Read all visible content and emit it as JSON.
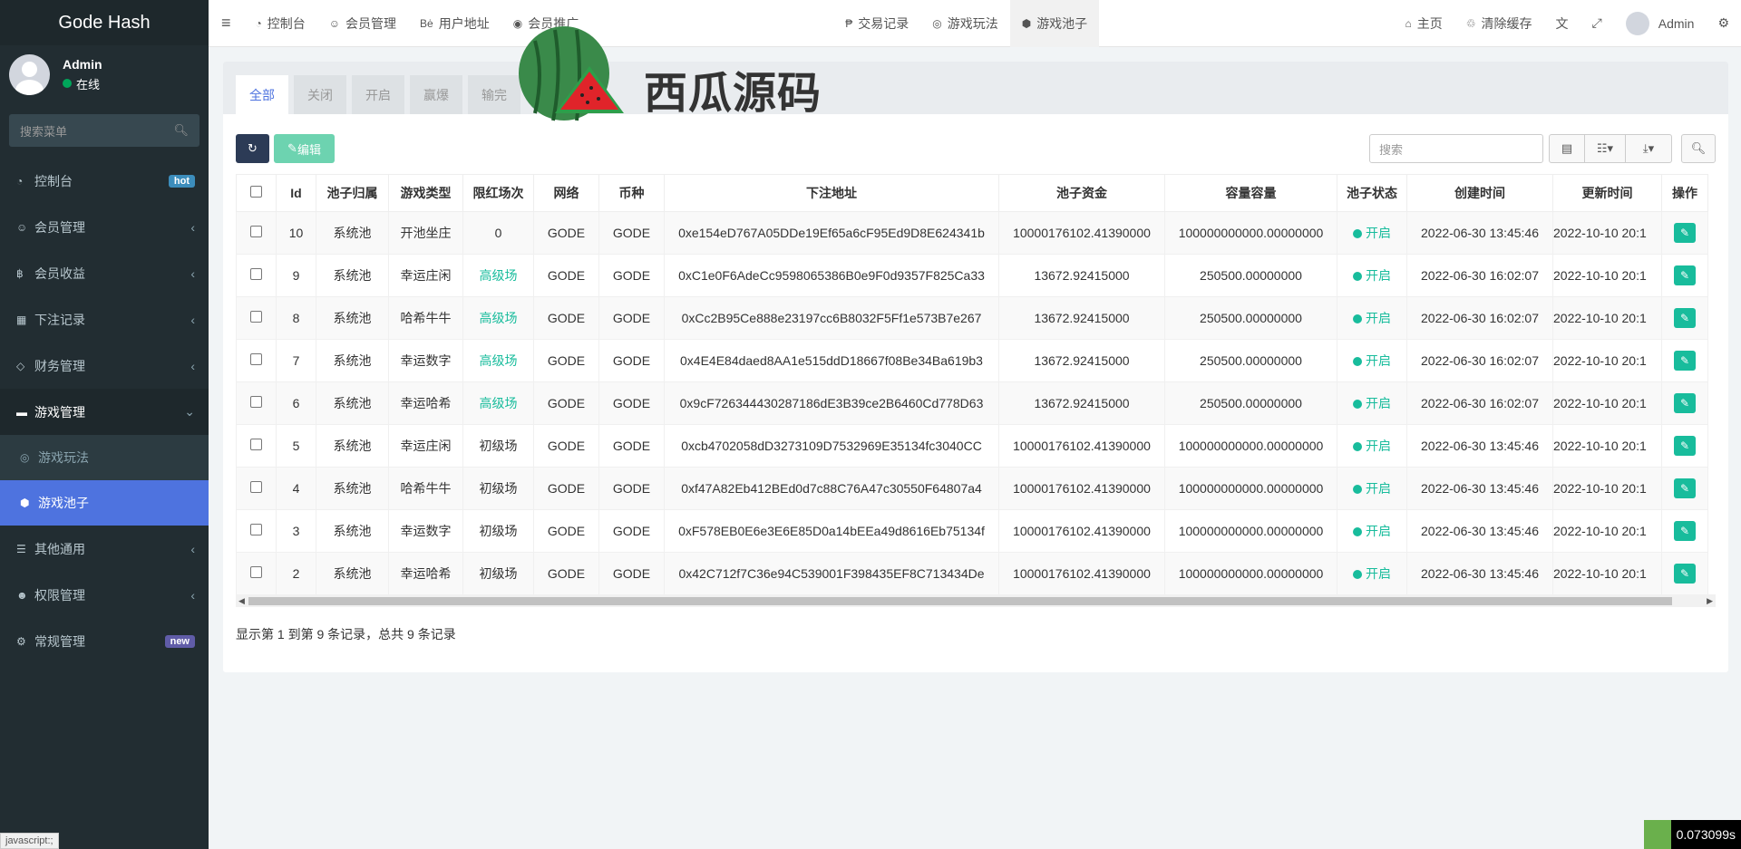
{
  "app": {
    "brand": "Gode Hash"
  },
  "user": {
    "name": "Admin",
    "status": "在线"
  },
  "sidebar": {
    "search_placeholder": "搜索菜单",
    "items": [
      {
        "label": "控制台",
        "badge": "hot"
      },
      {
        "label": "会员管理"
      },
      {
        "label": "会员收益"
      },
      {
        "label": "下注记录"
      },
      {
        "label": "财务管理"
      },
      {
        "label": "游戏管理"
      },
      {
        "label": "其他通用"
      },
      {
        "label": "权限管理"
      },
      {
        "label": "常规管理",
        "badge": "new"
      }
    ],
    "sub_items": [
      {
        "label": "游戏玩法"
      },
      {
        "label": "游戏池子"
      }
    ]
  },
  "status_url": "javascript:;",
  "topbar": {
    "items": [
      "控制台",
      "会员管理",
      "用户地址",
      "会员推广",
      "交易记录",
      "游戏玩法",
      "游戏池子"
    ],
    "right": {
      "home": "主页",
      "clear_cache": "清除缓存",
      "user": "Admin"
    }
  },
  "tabs": [
    "全部",
    "关闭",
    "开启",
    "赢爆",
    "输完"
  ],
  "toolbar": {
    "edit": "编辑",
    "search_placeholder": "搜索"
  },
  "table": {
    "headers": [
      "Id",
      "池子归属",
      "游戏类型",
      "限红场次",
      "网络",
      "币种",
      "下注地址",
      "池子资金",
      "容量容量",
      "池子状态",
      "创建时间",
      "更新时间",
      "操作"
    ],
    "rows": [
      {
        "id": "10",
        "owner": "系统池",
        "game": "开池坐庄",
        "level": "0",
        "net": "GODE",
        "coin": "GODE",
        "addr": "0xe154eD767A05DDe19Ef65a6cF95Ed9D8E624341b",
        "funds": "10000176102.41390000",
        "cap": "100000000000.00000000",
        "status": "开启",
        "created": "2022-06-30 13:45:46",
        "updated": "2022-10-10 20:1"
      },
      {
        "id": "9",
        "owner": "系统池",
        "game": "幸运庄闲",
        "level": "高级场",
        "net": "GODE",
        "coin": "GODE",
        "addr": "0xC1e0F6AdeCc9598065386B0e9F0d9357F825Ca33",
        "funds": "13672.92415000",
        "cap": "250500.00000000",
        "status": "开启",
        "created": "2022-06-30 16:02:07",
        "updated": "2022-10-10 20:1"
      },
      {
        "id": "8",
        "owner": "系统池",
        "game": "哈希牛牛",
        "level": "高级场",
        "net": "GODE",
        "coin": "GODE",
        "addr": "0xCc2B95Ce888e23197cc6B8032F5Ff1e573B7e267",
        "funds": "13672.92415000",
        "cap": "250500.00000000",
        "status": "开启",
        "created": "2022-06-30 16:02:07",
        "updated": "2022-10-10 20:1"
      },
      {
        "id": "7",
        "owner": "系统池",
        "game": "幸运数字",
        "level": "高级场",
        "net": "GODE",
        "coin": "GODE",
        "addr": "0x4E4E84daed8AA1e515ddD18667f08Be34Ba619b3",
        "funds": "13672.92415000",
        "cap": "250500.00000000",
        "status": "开启",
        "created": "2022-06-30 16:02:07",
        "updated": "2022-10-10 20:1"
      },
      {
        "id": "6",
        "owner": "系统池",
        "game": "幸运哈希",
        "level": "高级场",
        "net": "GODE",
        "coin": "GODE",
        "addr": "0x9cF726344430287186dE3B39ce2B6460Cd778D63",
        "funds": "13672.92415000",
        "cap": "250500.00000000",
        "status": "开启",
        "created": "2022-06-30 16:02:07",
        "updated": "2022-10-10 20:1"
      },
      {
        "id": "5",
        "owner": "系统池",
        "game": "幸运庄闲",
        "level": "初级场",
        "net": "GODE",
        "coin": "GODE",
        "addr": "0xcb4702058dD3273109D7532969E35134fc3040CC",
        "funds": "10000176102.41390000",
        "cap": "100000000000.00000000",
        "status": "开启",
        "created": "2022-06-30 13:45:46",
        "updated": "2022-10-10 20:1"
      },
      {
        "id": "4",
        "owner": "系统池",
        "game": "哈希牛牛",
        "level": "初级场",
        "net": "GODE",
        "coin": "GODE",
        "addr": "0xf47A82Eb412BEd0d7c88C76A47c30550F64807a4",
        "funds": "10000176102.41390000",
        "cap": "100000000000.00000000",
        "status": "开启",
        "created": "2022-06-30 13:45:46",
        "updated": "2022-10-10 20:1"
      },
      {
        "id": "3",
        "owner": "系统池",
        "game": "幸运数字",
        "level": "初级场",
        "net": "GODE",
        "coin": "GODE",
        "addr": "0xF578EB0E6e3E6E85D0a14bEEa49d8616Eb75134f",
        "funds": "10000176102.41390000",
        "cap": "100000000000.00000000",
        "status": "开启",
        "created": "2022-06-30 13:45:46",
        "updated": "2022-10-10 20:1"
      },
      {
        "id": "2",
        "owner": "系统池",
        "game": "幸运哈希",
        "level": "初级场",
        "net": "GODE",
        "coin": "GODE",
        "addr": "0x42C712f7C36e94C539001F398435EF8C713434De",
        "funds": "10000176102.41390000",
        "cap": "100000000000.00000000",
        "status": "开启",
        "created": "2022-06-30 13:45:46",
        "updated": "2022-10-10 20:1"
      }
    ]
  },
  "pagination_info": "显示第 1 到第 9 条记录，总共 9 条记录",
  "watermark": "西瓜源码",
  "timer": "0.073099s",
  "colors": {
    "sidebar": "#222d32",
    "active": "#4e73df",
    "accent": "#18bc9c"
  }
}
